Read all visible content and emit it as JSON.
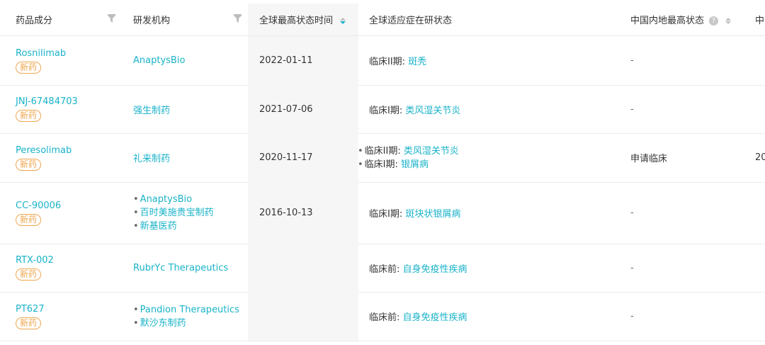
{
  "header": {
    "col_drug": "药品成分",
    "col_org": "研发机构",
    "col_date": "全球最高状态时间",
    "col_indication": "全球适应症在研状态",
    "col_cn": "中国内地最高状态",
    "col_next": "中"
  },
  "rows": [
    {
      "drug": "Rosnilimab",
      "badge": "新药",
      "orgs": [
        "AnaptysBio"
      ],
      "date": "2022-01-11",
      "indications": [
        {
          "phase": "临床II期:",
          "disease": "斑秃"
        }
      ],
      "cn_status": "-",
      "next": ""
    },
    {
      "drug": "JNJ-67484703",
      "badge": "新药",
      "orgs": [
        "强生制药"
      ],
      "date": "2021-07-06",
      "indications": [
        {
          "phase": "临床I期:",
          "disease": "类风湿关节炎"
        }
      ],
      "cn_status": "-",
      "next": ""
    },
    {
      "drug": "Peresolimab",
      "badge": "新药",
      "orgs": [
        "礼来制药"
      ],
      "date": "2020-11-17",
      "indications": [
        {
          "phase": "临床II期:",
          "disease": "类风湿关节炎"
        },
        {
          "phase": "临床I期:",
          "disease": "银屑病"
        }
      ],
      "cn_status": "申请临床",
      "next": "20"
    },
    {
      "drug": "CC-90006",
      "badge": "新药",
      "orgs": [
        "AnaptysBio",
        "百时美施贵宝制药",
        "新基医药"
      ],
      "date": "2016-10-13",
      "indications": [
        {
          "phase": "临床I期:",
          "disease": "斑块状银屑病"
        }
      ],
      "cn_status": "-",
      "next": ""
    },
    {
      "drug": "RTX-002",
      "badge": "新药",
      "orgs": [
        "RubrYc Therapeutics"
      ],
      "date": "",
      "indications": [
        {
          "phase": "临床前:",
          "disease": "自身免疫性疾病"
        }
      ],
      "cn_status": "-",
      "next": ""
    },
    {
      "drug": "PT627",
      "badge": "新药",
      "orgs": [
        "Pandion Therapeutics",
        "默沙东制药"
      ],
      "date": "",
      "indications": [
        {
          "phase": "临床前:",
          "disease": "自身免疫性疾病"
        }
      ],
      "cn_status": "-",
      "next": ""
    }
  ],
  "colors": {
    "link": "#1ab3c9",
    "badge": "#f0a64e",
    "sorted_bg": "#f6f6f6"
  },
  "icons": {
    "filter": "filter-icon",
    "sort": "sort-icon",
    "help": "help-icon"
  }
}
